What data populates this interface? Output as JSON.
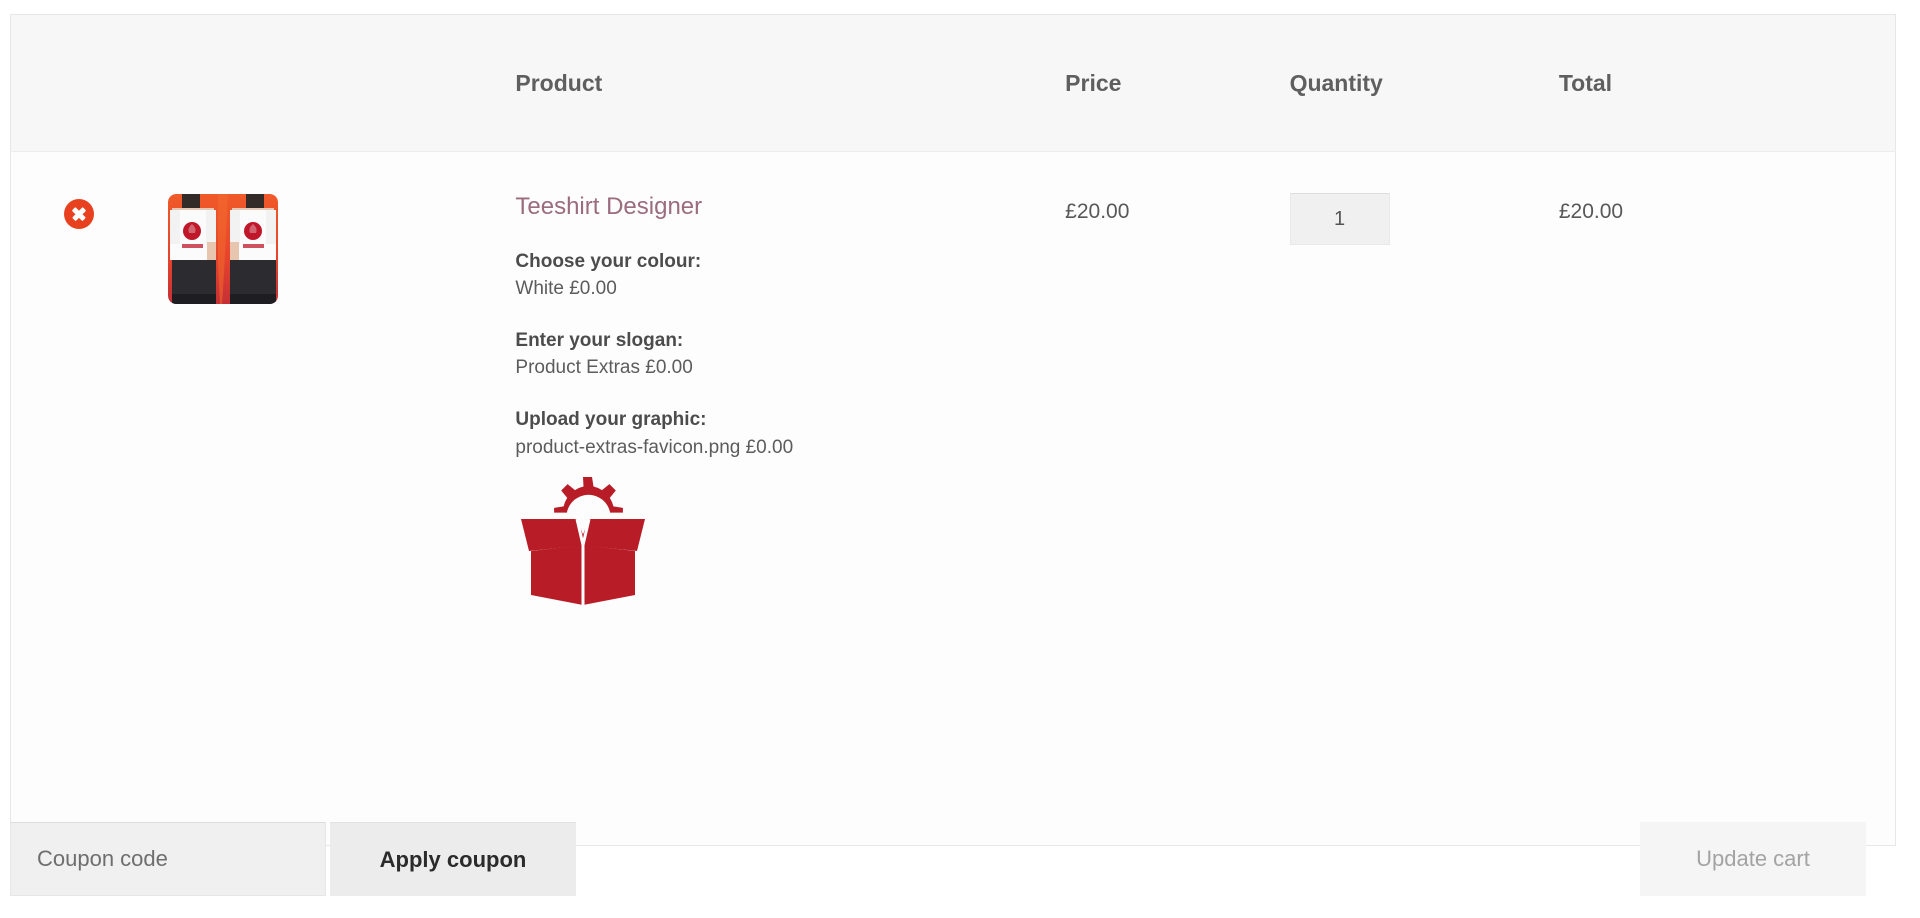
{
  "cart": {
    "headers": {
      "remove": "",
      "thumbnail": "",
      "product": "Product",
      "price": "Price",
      "quantity": "Quantity",
      "total": "Total"
    },
    "items": [
      {
        "remove_label": "×",
        "name": "Teeshirt Designer",
        "price": "£20.00",
        "quantity": "1",
        "total": "£20.00",
        "thumbnail_icon": "teeshirt-photo",
        "variations": [
          {
            "label": "Choose your colour:",
            "value": "White £0.00"
          },
          {
            "label": "Enter your slogan:",
            "value": "Product Extras £0.00"
          },
          {
            "label": "Upload your graphic:",
            "value": "product-extras-favicon.png £0.00"
          }
        ],
        "uploaded_graphic_icon": "product-extras-box-gear-icon"
      }
    ]
  },
  "actions": {
    "coupon_placeholder": "Coupon code",
    "coupon_value": "",
    "apply_coupon_label": "Apply coupon",
    "update_cart_label": "Update cart"
  },
  "colors": {
    "remove_button": "#e8411f",
    "product_link": "#9b6b7e",
    "header_background": "#f7f7f7",
    "graphic_red": "#b81d27",
    "button_background": "#ececec"
  }
}
